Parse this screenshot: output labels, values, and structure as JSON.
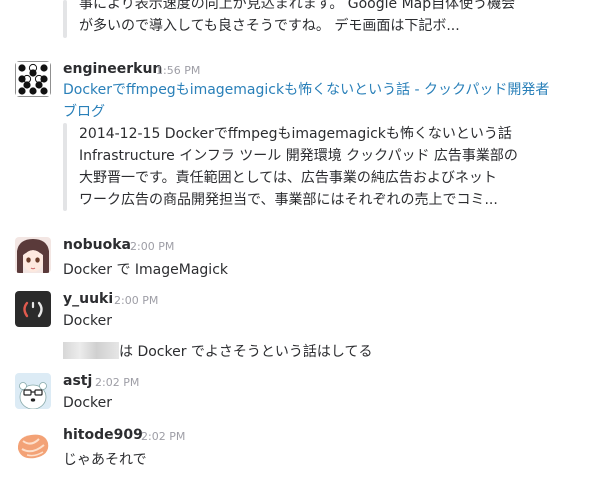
{
  "prev_quote": {
    "lines": [
      "事により表示速度の向上が見込まれます。 Google Map自体使う機会",
      "が多いので導入しても良さそうですね。 デモ画面は下記ボ..."
    ]
  },
  "messages": [
    {
      "author": "engineerkun",
      "time": "1:56 PM",
      "link_lines": [
        "Dockerでffmpegもimagemagickも怖くないという話 - クックパッド開発者",
        "ブログ"
      ],
      "quote_lines": [
        "2014-12-15 Dockerでffmpegもimagemagickも怖くないという話",
        "Infrastructure インフラ ツール 開発環境 クックパッド 広告事業部の",
        "大野晋一です。責任範囲としては、広告事業の純広告およびネット",
        "ワーク広告の商品開発担当で、事業部にはそれぞれの売上でコミ..."
      ]
    },
    {
      "author": "nobuoka",
      "time": "2:00 PM",
      "text": "Docker で ImageMagick"
    },
    {
      "author": "y_uuki",
      "time": "2:00 PM",
      "text": "Docker",
      "followup_text": "は Docker でよさそうという話はしてる"
    },
    {
      "author": "astj",
      "time": "2:02 PM",
      "text": "Docker"
    },
    {
      "author": "hitode909",
      "time": "2:02 PM",
      "text": "じゃあそれで"
    }
  ],
  "colors": {
    "link": "#2a80b9",
    "timestamp": "#9e9ea6",
    "text": "#2c2d30",
    "quote_bar": "#e3e4e6"
  }
}
